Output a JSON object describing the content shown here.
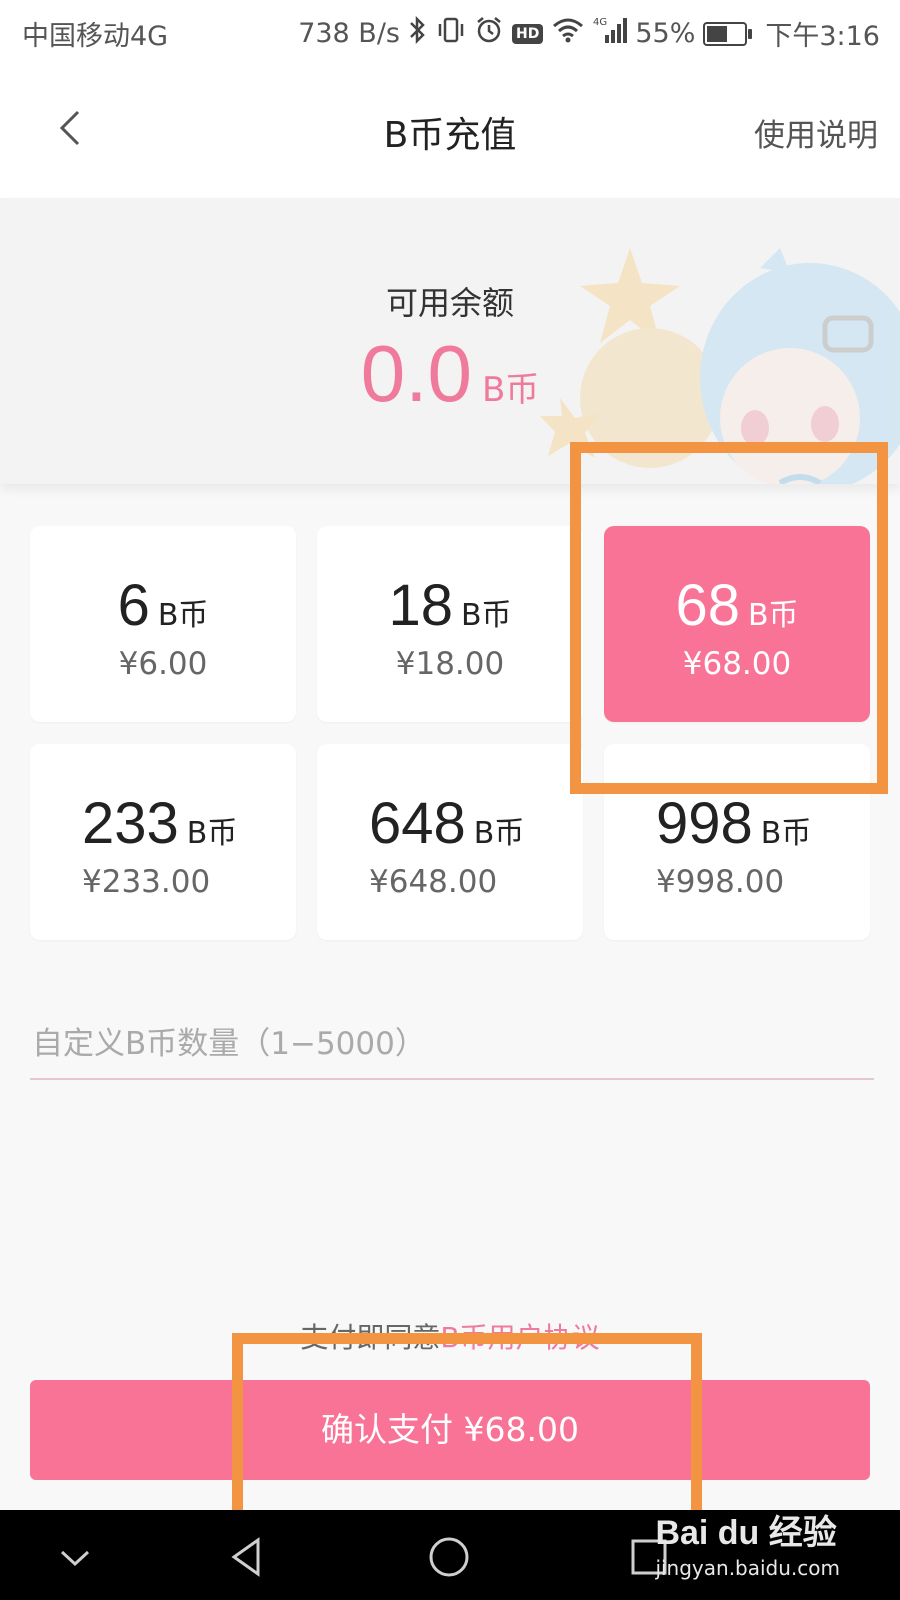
{
  "status_bar": {
    "carrier": "中国移动4G",
    "net_speed": "738 B/s",
    "hd": "HD",
    "signal_label": "4G",
    "battery": "55%",
    "time": "下午3:16"
  },
  "header": {
    "title": "B币充值",
    "help_label": "使用说明"
  },
  "balance": {
    "label": "可用余额",
    "value": "0.0",
    "unit": "B币"
  },
  "options": [
    {
      "amount": "6",
      "unit": "B币",
      "price": "¥6.00",
      "selected": false
    },
    {
      "amount": "18",
      "unit": "B币",
      "price": "¥18.00",
      "selected": false
    },
    {
      "amount": "68",
      "unit": "B币",
      "price": "¥68.00",
      "selected": true
    },
    {
      "amount": "233",
      "unit": "B币",
      "price": "¥233.00",
      "selected": false
    },
    {
      "amount": "648",
      "unit": "B币",
      "price": "¥648.00",
      "selected": false
    },
    {
      "amount": "998",
      "unit": "B币",
      "price": "¥998.00",
      "selected": false
    }
  ],
  "custom": {
    "placeholder": "自定义B币数量（1−5000）"
  },
  "agreement": {
    "prefix": "支付即同意",
    "link": "B币用户协议"
  },
  "pay_button": {
    "label": "确认支付 ¥68.00"
  },
  "watermark": {
    "main": "Bai du 经验",
    "sub": "jingyan.baidu.com"
  },
  "colors": {
    "accent": "#f97397",
    "balance": "#f07a9b",
    "annotation": "#f39443"
  }
}
